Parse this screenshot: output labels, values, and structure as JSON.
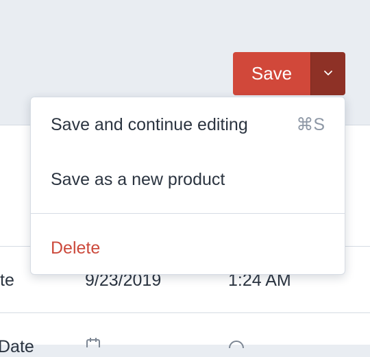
{
  "toolbar": {
    "save_label": "Save",
    "save_color": "#d1483a",
    "dropdown_color": "#8e3126",
    "dropdown_icon": "chevron-down-icon"
  },
  "save_menu": {
    "items": [
      {
        "label": "Save and continue editing",
        "shortcut": "⌘S"
      },
      {
        "label": "Save as a new product",
        "shortcut": ""
      },
      {
        "label": "Delete",
        "shortcut": "",
        "color": "#cc4a3c"
      }
    ]
  },
  "background": {
    "rows": [
      {
        "label": "te",
        "date": "9/23/2019",
        "time": "1:24 AM"
      },
      {
        "label": "Date",
        "date_icon": "calendar-icon",
        "time_icon": "clock-icon"
      }
    ]
  }
}
